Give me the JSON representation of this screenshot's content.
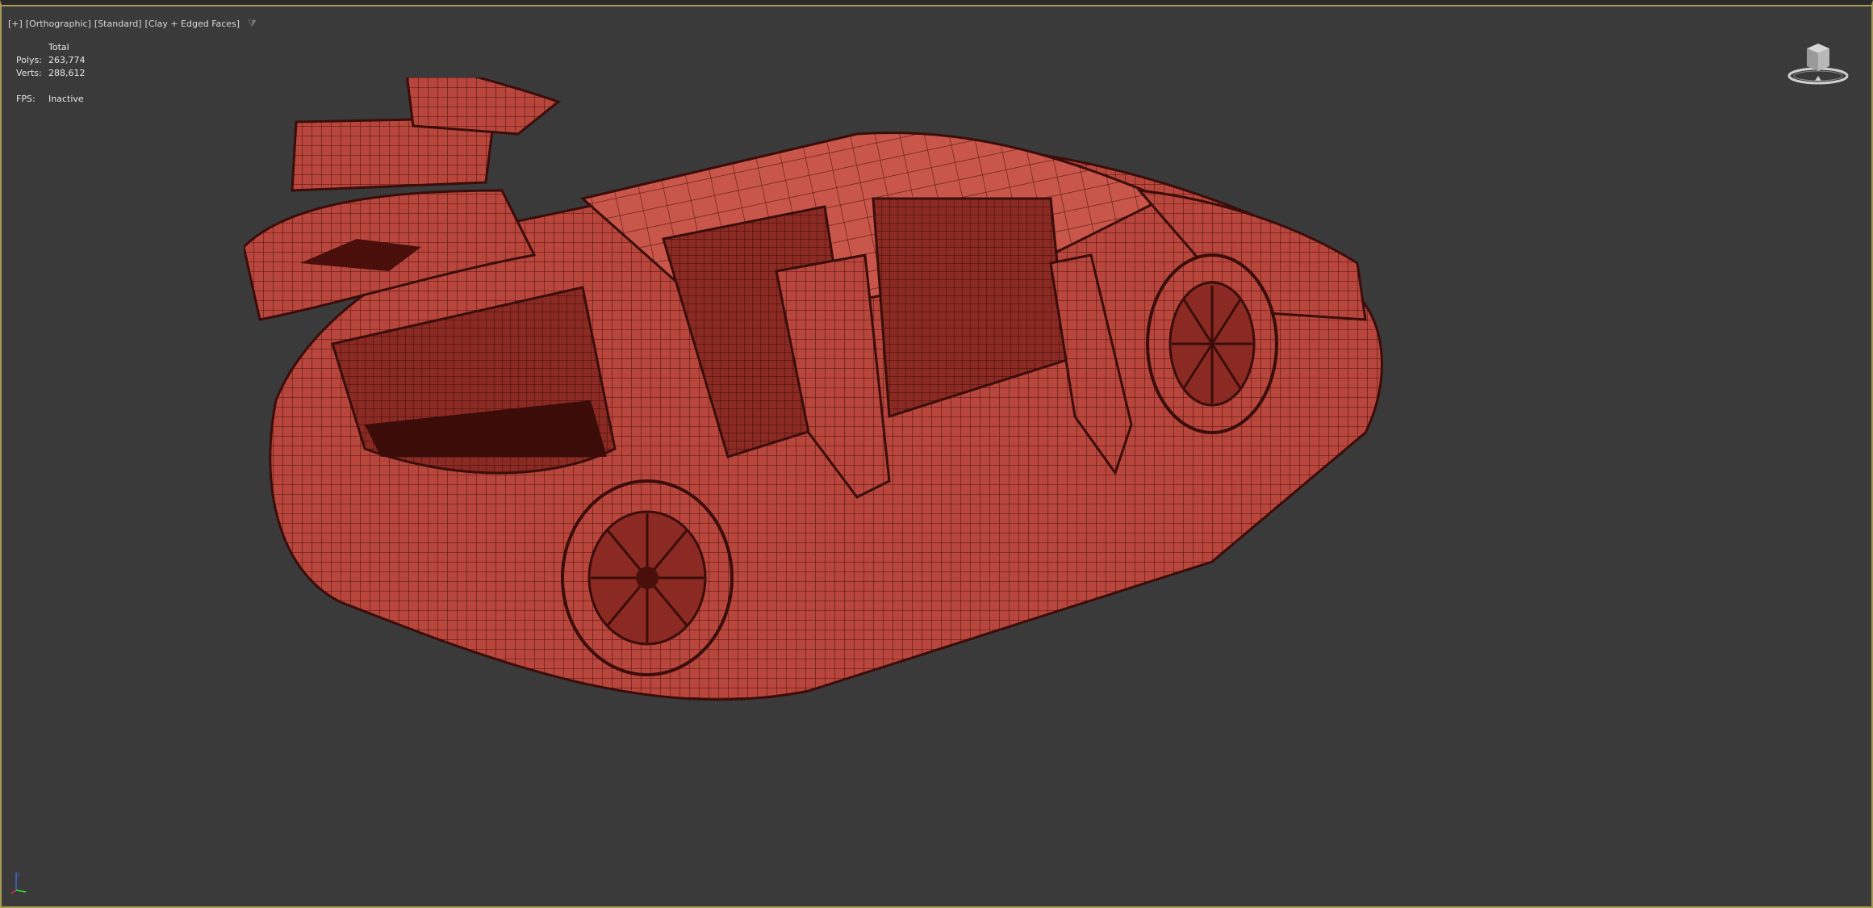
{
  "viewport": {
    "label": {
      "plus": "[+]",
      "view": "[Orthographic]",
      "shading": "[Standard]",
      "style": "[Clay + Edged Faces]"
    },
    "stats": {
      "header": "Total",
      "polys_label": "Polys:",
      "polys_value": "263,774",
      "verts_label": "Verts:",
      "verts_value": "288,612",
      "fps_label": "FPS:",
      "fps_value": "Inactive"
    }
  },
  "icons": {
    "filter": "filter-icon",
    "viewcube": "viewcube-icon",
    "axis": "axis-gizmo-icon"
  },
  "colors": {
    "viewport_bg": "#3a3a3a",
    "active_border": "#a89a55",
    "model_clay": "#b8463c",
    "model_edges": "#3a0d0a"
  }
}
